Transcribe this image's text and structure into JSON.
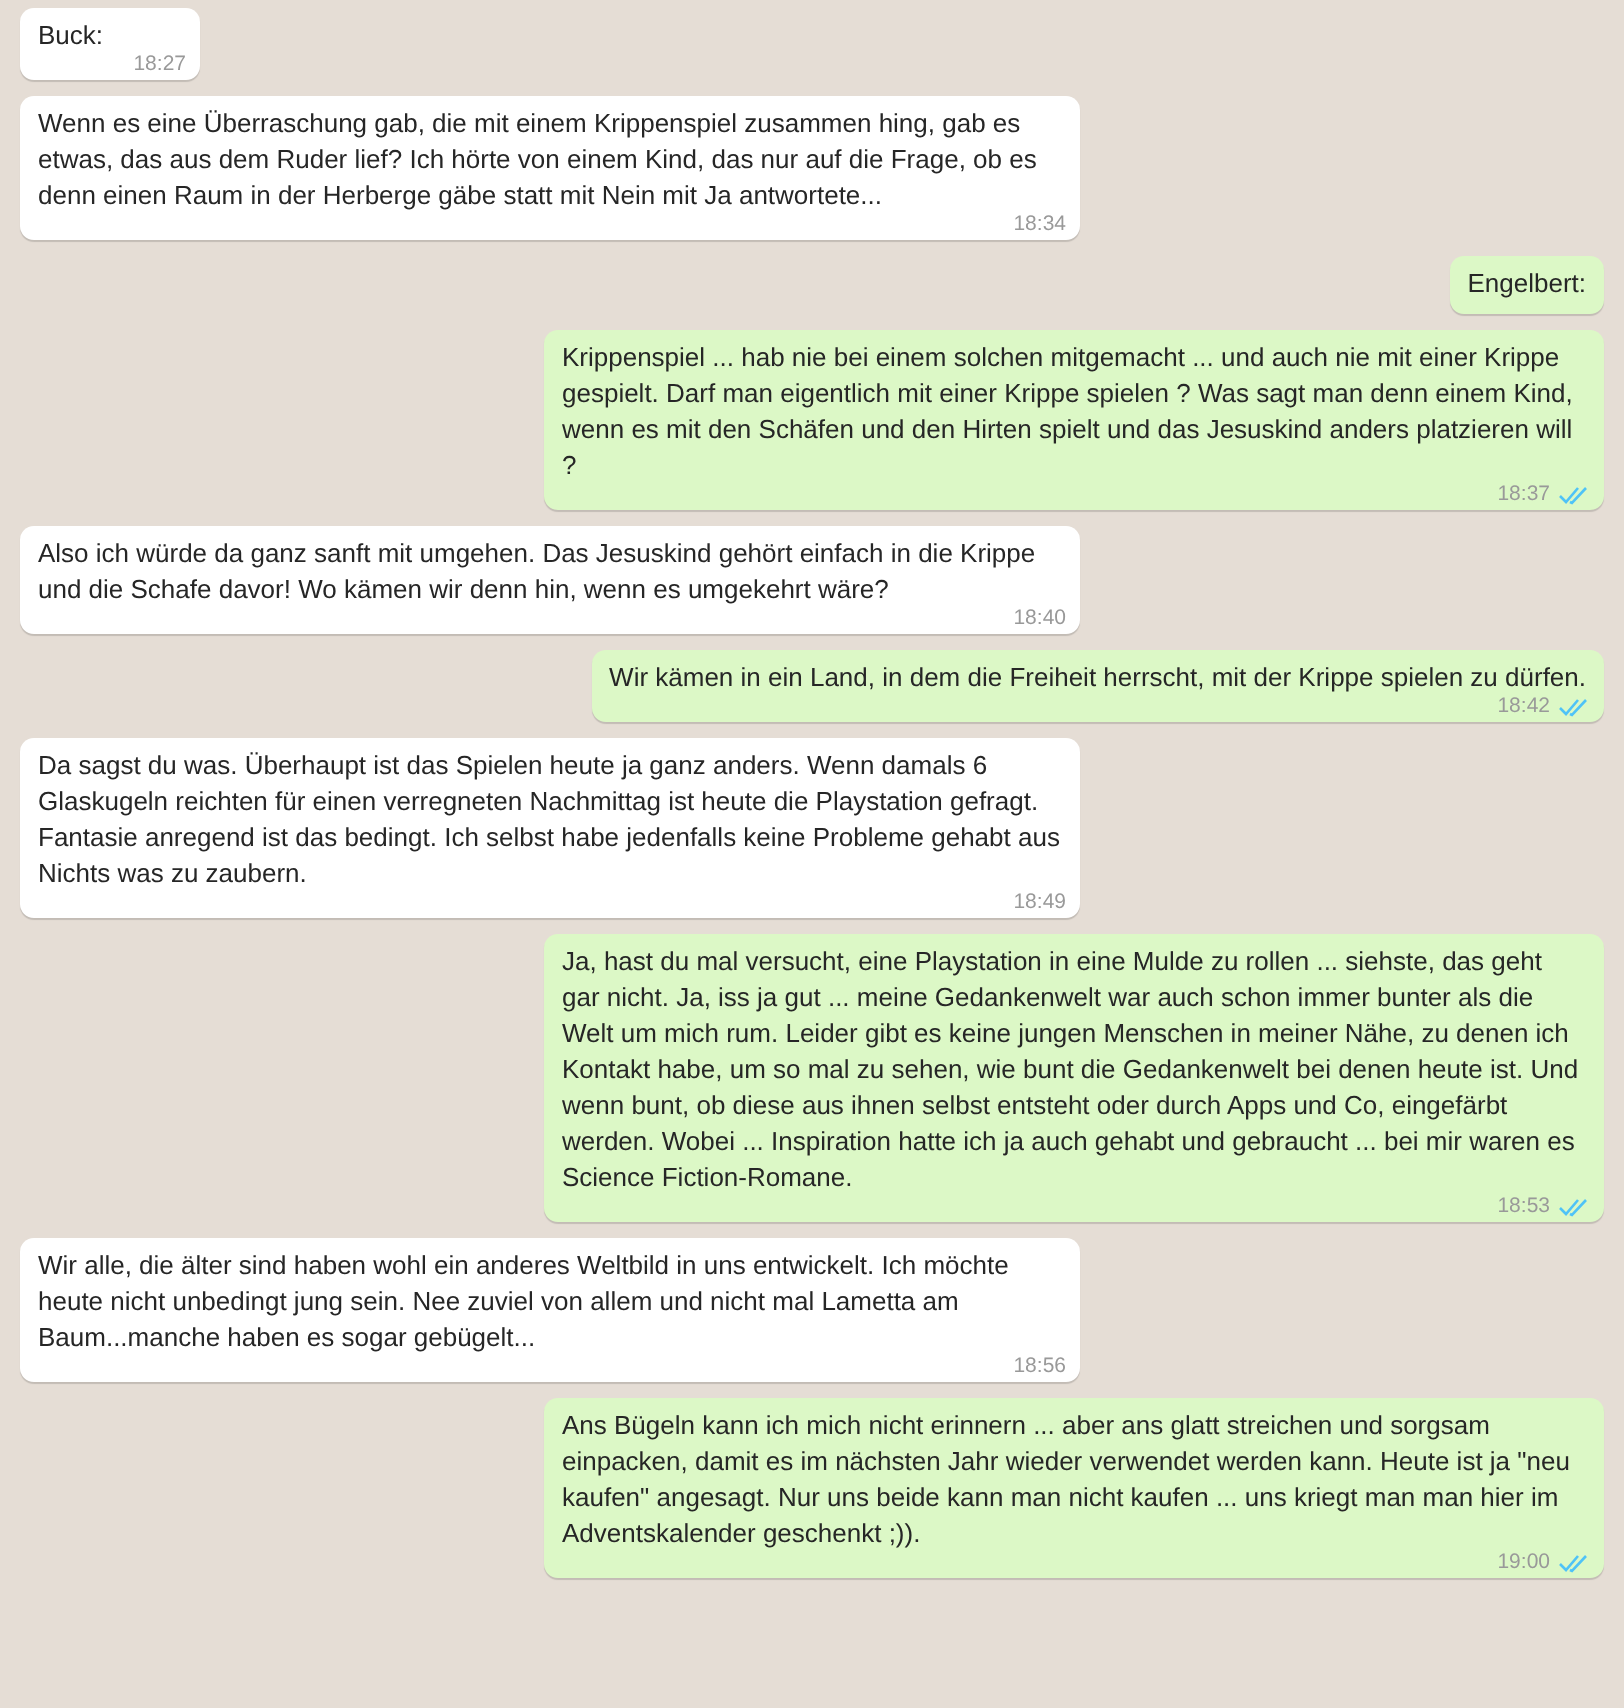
{
  "messages": [
    {
      "kind": "incoming",
      "text": "Buck:",
      "time": "18:27"
    },
    {
      "kind": "incoming",
      "text": "Wenn es eine Überraschung gab, die mit einem Krippenspiel zusammen hing, gab es etwas, das aus dem Ruder lief? Ich hörte von einem Kind, das nur auf die Frage, ob es denn einen Raum in der Herberge gäbe statt mit Nein mit Ja antwortete...",
      "time": "18:34"
    },
    {
      "kind": "outgoing",
      "text": "Engelbert:"
    },
    {
      "kind": "outgoing",
      "text": "Krippenspiel ... hab nie bei einem solchen mitgemacht ... und auch nie mit einer Krippe gespielt. Darf man eigentlich mit einer Krippe spielen ? Was sagt man denn einem Kind, wenn es mit den Schäfen und den Hirten spielt und das Jesuskind anders platzieren will ?",
      "time": "18:37",
      "read": true
    },
    {
      "kind": "incoming",
      "text": "Also ich würde da ganz sanft mit umgehen. Das Jesuskind gehört einfach in die Krippe und die Schafe davor! Wo kämen wir denn hin, wenn es umgekehrt wäre?",
      "time": "18:40"
    },
    {
      "kind": "outgoing",
      "text": "Wir kämen in ein Land, in dem die Freiheit herrscht, mit der Krippe spielen zu dürfen.",
      "time": "18:42",
      "read": true
    },
    {
      "kind": "incoming",
      "text": "Da sagst du was. Überhaupt ist das Spielen heute ja ganz anders. Wenn damals 6 Glaskugeln reichten für einen verregneten Nachmittag ist heute die Playstation gefragt.  Fantasie anregend ist das bedingt. Ich selbst habe jedenfalls keine Probleme gehabt aus Nichts was zu zaubern.",
      "time": "18:49"
    },
    {
      "kind": "outgoing",
      "text": "Ja, hast du mal versucht, eine Playstation in eine Mulde zu rollen ... siehste, das geht gar nicht. Ja, iss ja gut ... meine Gedankenwelt war auch schon immer bunter als die Welt um mich rum. Leider gibt es keine jungen Menschen in meiner Nähe, zu denen ich Kontakt habe, um so mal zu sehen, wie bunt die Gedankenwelt bei denen heute ist. Und wenn bunt, ob diese aus ihnen selbst entsteht oder durch Apps und Co, eingefärbt werden. Wobei ... Inspiration hatte ich ja auch gehabt und gebraucht ... bei mir waren es Science Fiction-Romane.",
      "time": "18:53",
      "read": true
    },
    {
      "kind": "incoming",
      "text": "Wir alle, die älter sind haben wohl ein anderes Weltbild in uns entwickelt. Ich möchte heute nicht unbedingt jung sein. Nee zuviel von allem und nicht mal Lametta am Baum...manche haben es sogar gebügelt...",
      "time": "18:56"
    },
    {
      "kind": "outgoing",
      "text": "Ans Bügeln kann ich mich nicht erinnern ... aber ans glatt streichen und sorgsam einpacken, damit es im nächsten Jahr wieder verwendet werden kann. Heute ist ja \"neu kaufen\" angesagt. Nur uns beide kann man nicht kaufen ... uns kriegt man man hier im Adventskalender geschenkt ;)).",
      "time": "19:00",
      "read": true
    }
  ]
}
